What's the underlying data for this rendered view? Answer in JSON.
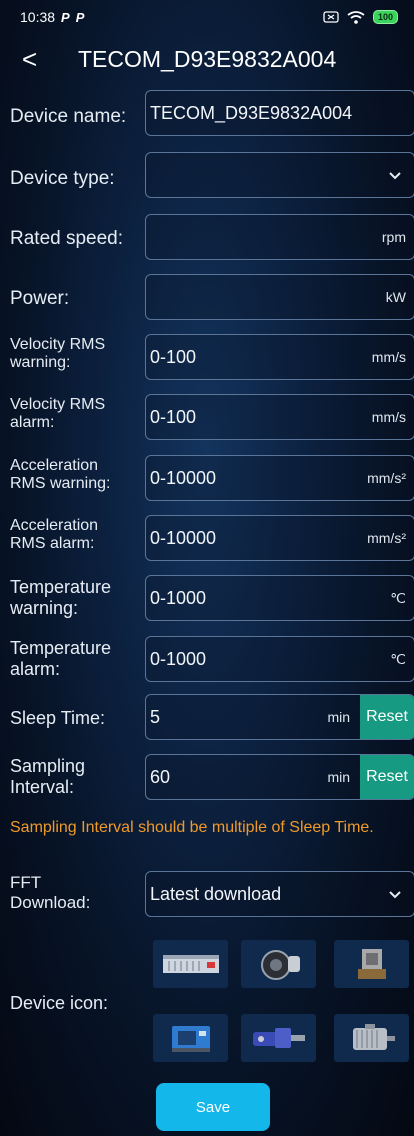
{
  "status": {
    "time": "10:38",
    "notif1": "P",
    "notif2": "P",
    "battery": "100"
  },
  "header": {
    "back": "<",
    "title": "TECOM_D93E9832A004"
  },
  "fields": {
    "device_name": {
      "label": "Device name:",
      "value": "TECOM_D93E9832A004"
    },
    "device_type": {
      "label": "Device type:",
      "value": ""
    },
    "rated_speed": {
      "label": "Rated speed:",
      "value": "",
      "unit": "rpm"
    },
    "power": {
      "label": "Power:",
      "value": "",
      "unit": "kW"
    },
    "vel_rms_warning": {
      "label_1": "Velocity RMS",
      "label_2": "warning:",
      "value": "0-100",
      "unit": "mm/s"
    },
    "vel_rms_alarm": {
      "label_1": "Velocity RMS",
      "label_2": "alarm:",
      "value": "0-100",
      "unit": "mm/s"
    },
    "acc_rms_warning": {
      "label_1": "Acceleration",
      "label_2": "RMS warning:",
      "value": "0-10000",
      "unit": "mm/s²"
    },
    "acc_rms_alarm": {
      "label_1": "Acceleration",
      "label_2": "RMS alarm:",
      "value": "0-10000",
      "unit": "mm/s²"
    },
    "temp_warning": {
      "label_1": "Temperature",
      "label_2": "warning:",
      "value": "0-1000",
      "unit": "℃"
    },
    "temp_alarm": {
      "label_1": "Temperature",
      "label_2": "alarm:",
      "value": "0-1000",
      "unit": "℃"
    },
    "sleep_time": {
      "label": "Sleep Time:",
      "value": "5",
      "unit": "min",
      "reset": "Reset"
    },
    "sampling_interval": {
      "label_1": "Sampling",
      "label_2": "Interval:",
      "value": "60",
      "unit": "min",
      "reset": "Reset"
    }
  },
  "warning_text": "Sampling Interval should be multiple of Sleep Time.",
  "fft": {
    "label_1": "FFT",
    "label_2": "Download:",
    "value": "Latest download"
  },
  "device_icon": {
    "label": "Device icon:",
    "icons": [
      "air-conditioner-icon",
      "compressor-icon",
      "pump-icon",
      "cnc-machine-icon",
      "gear-motor-icon",
      "motor-icon"
    ]
  },
  "save_label": "Save"
}
